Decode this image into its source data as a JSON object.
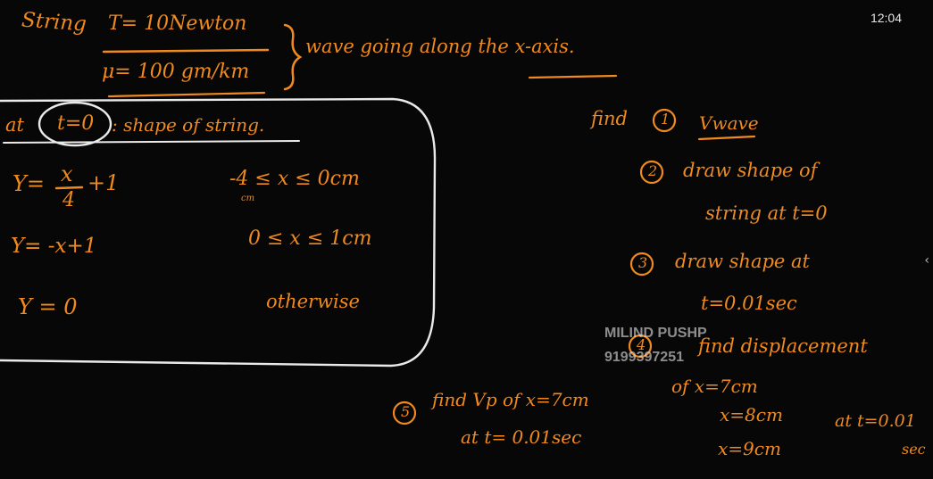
{
  "status": {
    "clock": "12:04"
  },
  "given": {
    "string_label": "String",
    "tension": "T= 10Newton",
    "mu": "μ= 100 gm/km",
    "wave_note": "wave going along the x-axis."
  },
  "shape_box": {
    "heading_prefix": "at",
    "heading_time": "t=0",
    "heading_suffix": ": shape of string.",
    "piece1_eq_y": "Y=",
    "piece1_eq_num": "x",
    "piece1_eq_den": "4",
    "piece1_eq_tail": "+1",
    "piece1_range": "-4 ≤ x ≤ 0cm",
    "piece1_range_unit": "cm",
    "piece2_eq": "Y= -x+1",
    "piece2_range": "0 ≤ x ≤ 1cm",
    "piece3_eq": "Y = 0",
    "piece3_range": "otherwise"
  },
  "tasks": {
    "find_label": "find",
    "t1_num": "1",
    "t1_text": "Vwave",
    "t2_num": "2",
    "t2_line1": "draw shape of",
    "t2_line2": "string at t=0",
    "t3_num": "3",
    "t3_line1": "draw shape at",
    "t3_line2": "t=0.01sec",
    "t4_num": "4",
    "t4_line1": "find displacement",
    "t4_line2": "of x=7cm",
    "t4_line3": "x=8cm",
    "t4_line4": "x=9cm",
    "t4_at": "at t=0.01",
    "t4_unit": "sec",
    "t5_num": "5",
    "t5_line1": "find Vp of x=7cm",
    "t5_line2": "at t= 0.01sec"
  },
  "watermark": {
    "name": "MILIND PUSHP",
    "phone": "9199397251"
  },
  "colors": {
    "board": "#070707",
    "orange_ink": "#f08a1e",
    "white_chalk": "#f2f2f2"
  },
  "icons": {
    "side_panel": "chevron-left-icon"
  }
}
